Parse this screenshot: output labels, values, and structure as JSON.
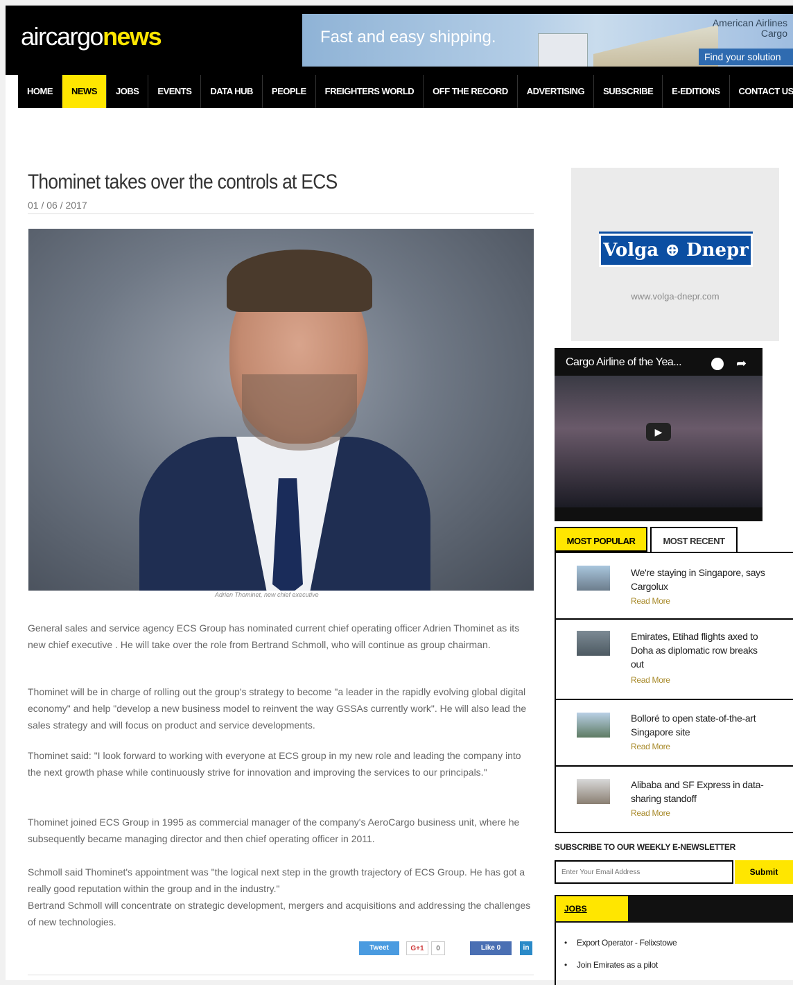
{
  "header": {
    "logo_part1": "aircargo",
    "logo_part2": "news",
    "banner": {
      "tagline": "Fast and easy shipping.",
      "brand_line1": "American Airlines",
      "brand_line2": "Cargo",
      "cta": "Find your solution"
    }
  },
  "nav": {
    "items": [
      "HOME",
      "NEWS",
      "JOBS",
      "EVENTS",
      "DATA HUB",
      "PEOPLE",
      "FREIGHTERS WORLD",
      "OFF THE RECORD",
      "ADVERTISING",
      "SUBSCRIBE",
      "E-EDITIONS",
      "CONTACT US"
    ],
    "active": "NEWS"
  },
  "article": {
    "title": "Thominet takes over the controls at ECS",
    "date": "01 / 06 / 2017",
    "caption": "Adrien Thominet, new chief executive",
    "paragraphs": [
      "General sales and service agency ECS Group has nominated current chief operating officer Adrien Thominet as its new chief executive . He will take over the role from Bertrand Schmoll, who will continue as group chairman.",
      "Thominet will be in charge of rolling out the group's strategy to become \"a leader in the rapidly evolving global digital economy\" and help \"develop a new business model to reinvent the way GSSAs currently work\". He will also lead the sales strategy and will focus on product and service developments.",
      "Thominet said: \"I look forward to working with everyone at ECS group in my new role and leading the company into the next growth phase while continuously strive for innovation and improving the services to our principals.\"",
      "Thominet joined ECS Group in 1995 as commercial manager of the company's AeroCargo business unit, where he subsequently became managing director and then chief operating officer in 2011.",
      "Schmoll said Thominet's appointment was \"the logical next step in the growth trajectory of ECS Group. He has got a really good reputation within the group and in the industry.\"",
      "Bertrand Schmoll will concentrate on strategic development, mergers and acquisitions and addressing the challenges of new technologies."
    ],
    "share": {
      "tweet": "Tweet",
      "gplus": "G+1",
      "gplus_count": "0",
      "like": "Like 0",
      "linkedin": "in"
    }
  },
  "sidebar": {
    "ad": {
      "brand": "Volga ⊕ Dnepr",
      "url": "www.volga-dnepr.com"
    },
    "video": {
      "title": "Cargo Airline of the Yea..."
    },
    "tabs": {
      "popular": "MOST POPULAR",
      "recent": "MOST RECENT"
    },
    "popular": [
      {
        "title": "We're staying in Singapore, says Cargolux",
        "read_more": "Read More"
      },
      {
        "title": "Emirates, Etihad flights axed to Doha as diplomatic row breaks out",
        "read_more": "Read More"
      },
      {
        "title": "Bolloré to open state-of-the-art Singapore site",
        "read_more": "Read More"
      },
      {
        "title": "Alibaba and SF Express in data-sharing standoff",
        "read_more": "Read More"
      }
    ],
    "newsletter": {
      "label": "SUBSCRIBE TO OUR WEEKLY E-NEWSLETTER",
      "placeholder": "Enter Your Email Address",
      "submit": "Submit"
    },
    "jobs": {
      "title": "JOBS",
      "items": [
        "Export Operator - Felixstowe",
        "Join Emirates as a pilot"
      ]
    }
  },
  "colors": {
    "accent": "#ffe600",
    "header_bg": "#000000"
  }
}
